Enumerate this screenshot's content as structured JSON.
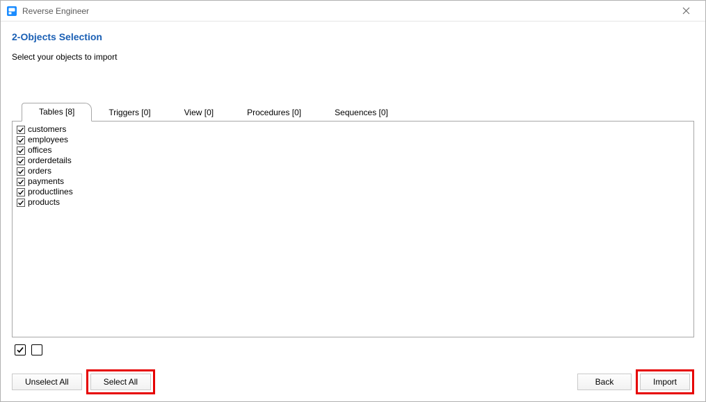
{
  "window": {
    "title": "Reverse Engineer"
  },
  "step": {
    "title": "2-Objects Selection",
    "desc": "Select your objects to import"
  },
  "tabs": [
    {
      "label": "Tables [8]",
      "active": true
    },
    {
      "label": "Triggers [0]",
      "active": false
    },
    {
      "label": "View [0]",
      "active": false
    },
    {
      "label": "Procedures [0]",
      "active": false
    },
    {
      "label": "Sequences [0]",
      "active": false
    }
  ],
  "items": [
    {
      "label": "customers",
      "checked": true
    },
    {
      "label": "employees",
      "checked": true
    },
    {
      "label": "offices",
      "checked": true
    },
    {
      "label": "orderdetails",
      "checked": true
    },
    {
      "label": "orders",
      "checked": true
    },
    {
      "label": "payments",
      "checked": true
    },
    {
      "label": "productlines",
      "checked": true
    },
    {
      "label": "products",
      "checked": true
    }
  ],
  "buttons": {
    "unselect_all": "Unselect All",
    "select_all": "Select All",
    "back": "Back",
    "import": "Import"
  }
}
